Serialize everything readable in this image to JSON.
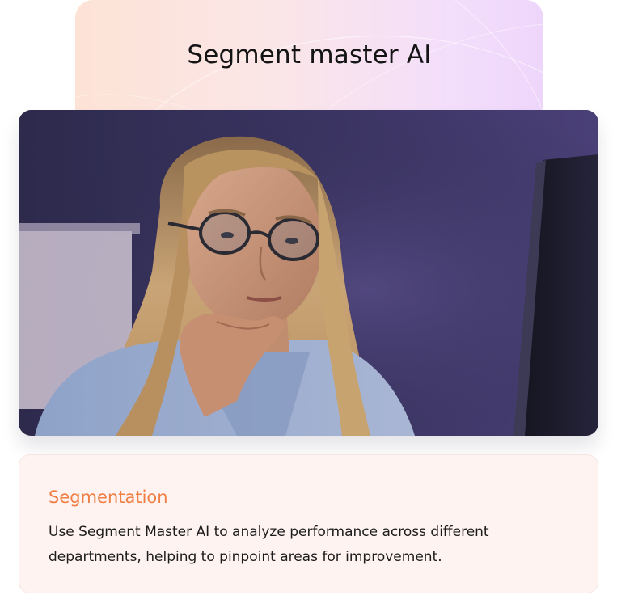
{
  "title_card": {
    "title": "Segment master AI"
  },
  "photo": {
    "alt": "Woman with glasses looking thoughtfully at a computer monitor"
  },
  "info_card": {
    "heading": "Segmentation",
    "body": "Use Segment Master AI to analyze performance across different departments, helping to pinpoint areas for improvement."
  },
  "colors": {
    "accent_orange": "#f07f45",
    "card_background": "#fef3f0",
    "title_gradient_start": "#fde3d6",
    "title_gradient_end": "#eed6fb"
  }
}
